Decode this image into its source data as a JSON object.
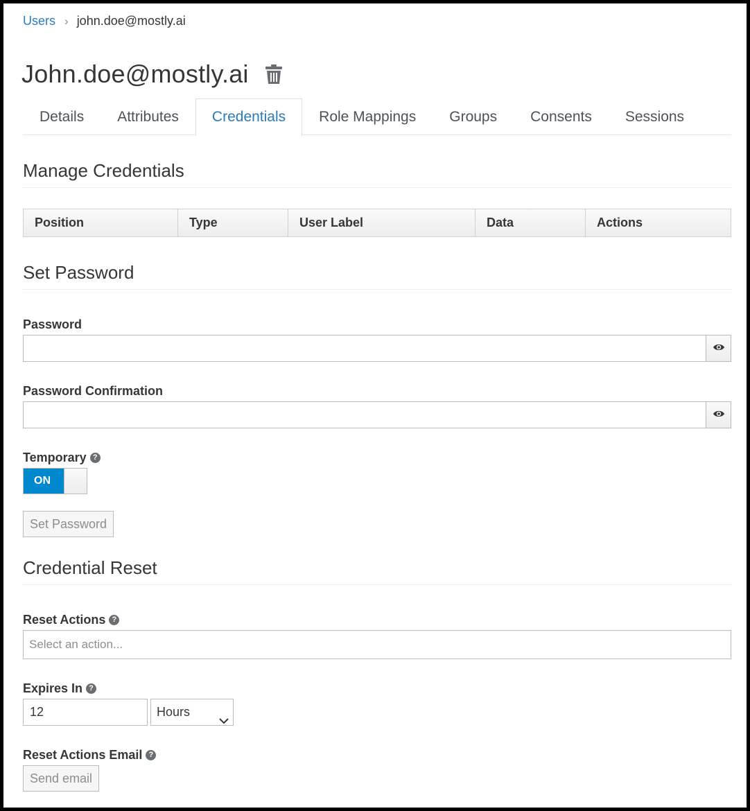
{
  "breadcrumb": {
    "root": "Users",
    "separator": "›",
    "current": "john.doe@mostly.ai"
  },
  "header": {
    "title": "John.doe@mostly.ai",
    "delete_icon": "trash-icon"
  },
  "tabs": [
    {
      "label": "Details"
    },
    {
      "label": "Attributes"
    },
    {
      "label": "Credentials",
      "active": true
    },
    {
      "label": "Role Mappings"
    },
    {
      "label": "Groups"
    },
    {
      "label": "Consents"
    },
    {
      "label": "Sessions"
    }
  ],
  "manage_credentials": {
    "title": "Manage Credentials",
    "columns": [
      "Position",
      "Type",
      "User Label",
      "Data",
      "Actions"
    ]
  },
  "set_password": {
    "title": "Set Password",
    "password_label": "Password",
    "password_value": "",
    "confirmation_label": "Password Confirmation",
    "confirmation_value": "",
    "show_icon": "eye-icon",
    "temporary_label": "Temporary",
    "temporary_toggle": "ON",
    "button_label": "Set Password"
  },
  "credential_reset": {
    "title": "Credential Reset",
    "reset_actions_label": "Reset Actions",
    "reset_actions_placeholder": "Select an action...",
    "expires_label": "Expires In",
    "expires_value": "12",
    "expires_unit": "Hours",
    "email_label": "Reset Actions Email",
    "email_button": "Send email"
  },
  "colors": {
    "accent": "#2b7bb9",
    "toggle_on": "#0088ce"
  }
}
